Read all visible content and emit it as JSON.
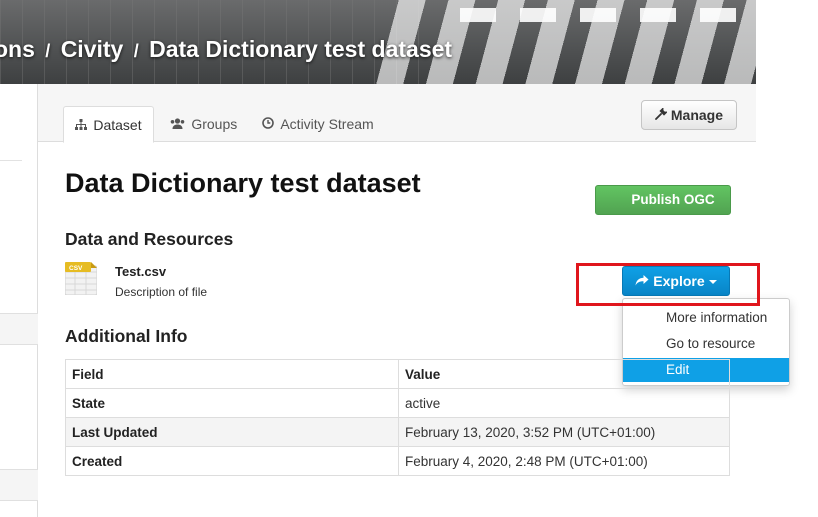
{
  "breadcrumb": {
    "part1": "ons",
    "part2": "Civity",
    "part3": "Data Dictionary test dataset",
    "separator": "/"
  },
  "tabs": [
    {
      "label": "Dataset",
      "icon": "sitemap-icon"
    },
    {
      "label": "Groups",
      "icon": "users-icon"
    },
    {
      "label": "Activity Stream",
      "icon": "clock-icon"
    }
  ],
  "manage_label": "Manage",
  "dataset_title": "Data Dictionary test dataset",
  "publish_label": "Publish OGC",
  "resources_heading": "Data and Resources",
  "resource": {
    "icon_label": "CSV",
    "title": "Test.csv",
    "description": "Description of file"
  },
  "explore_label": "Explore",
  "dropdown": [
    "More information",
    "Go to resource",
    "Edit"
  ],
  "additional_info_heading": "Additional Info",
  "table": {
    "headers": [
      "Field",
      "Value"
    ],
    "rows": [
      [
        "State",
        "active"
      ],
      [
        "Last Updated",
        "February 13, 2020, 3:52 PM (UTC+01:00)"
      ],
      [
        "Created",
        "February 4, 2020, 2:48 PM (UTC+01:00)"
      ]
    ]
  },
  "colors": {
    "explore": "#0fa0e6",
    "publish": "#51a351",
    "highlight": "#e0161c"
  }
}
